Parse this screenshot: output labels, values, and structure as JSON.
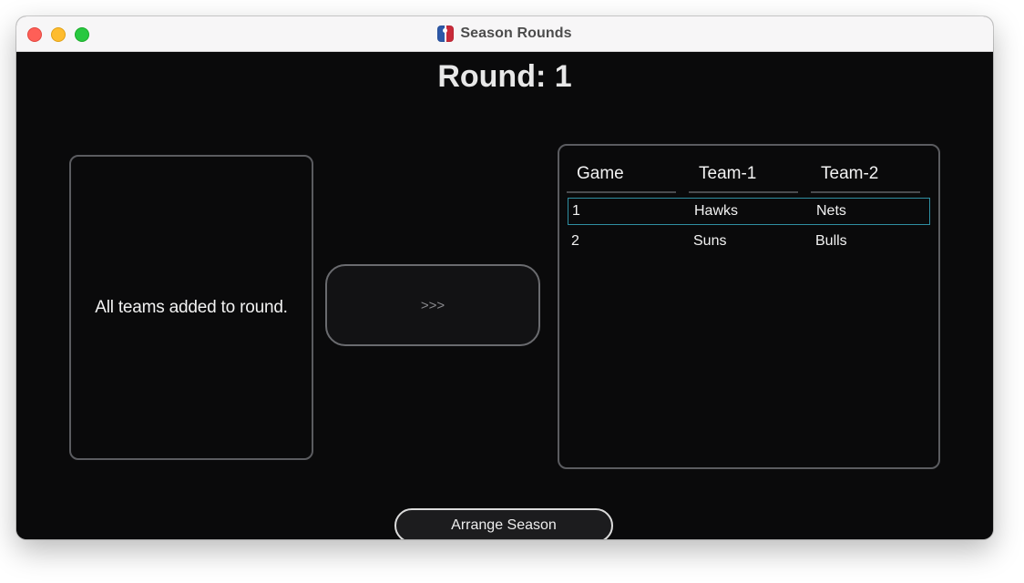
{
  "window": {
    "title": "Season Rounds",
    "app_icon": "nba-logo-icon"
  },
  "header": {
    "round_label": "Round: 1"
  },
  "teams_panel": {
    "message": "All teams added to round."
  },
  "transfer_button": {
    "label": ">>>"
  },
  "games_table": {
    "columns": [
      "Game",
      "Team-1",
      "Team-2"
    ],
    "rows": [
      {
        "game": "1",
        "team1": "Hawks",
        "team2": "Nets",
        "selected": true
      },
      {
        "game": "2",
        "team1": "Suns",
        "team2": "Bulls",
        "selected": false
      }
    ]
  },
  "footer": {
    "arrange_label": "Arrange Season"
  },
  "colors": {
    "background": "#0a0a0b",
    "panel_border": "#5b5c60",
    "selection_border": "#2f8fa3",
    "close": "#fe5f57",
    "minimize": "#febc2e",
    "maximize": "#28c840"
  }
}
